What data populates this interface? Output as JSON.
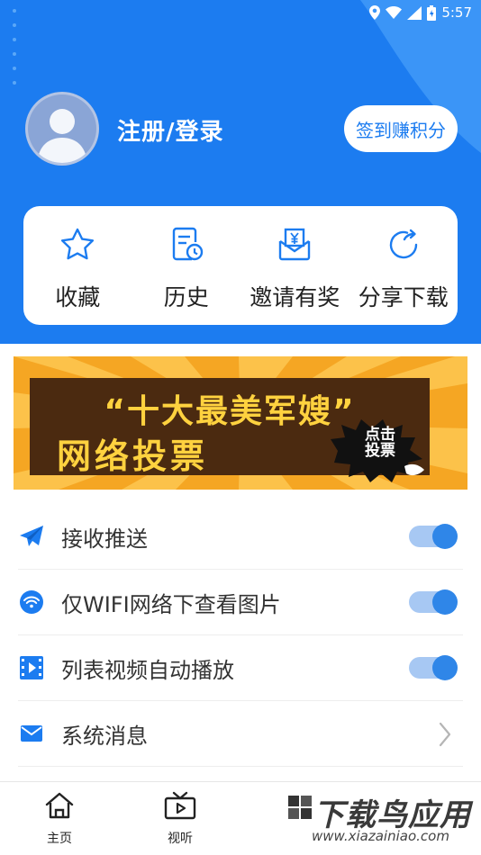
{
  "status_bar": {
    "time": "5:57"
  },
  "profile": {
    "login_label": "注册/登录",
    "signin_button": "签到赚积分"
  },
  "quick_actions": [
    {
      "label": "收藏",
      "icon": "star-icon"
    },
    {
      "label": "历史",
      "icon": "history-icon"
    },
    {
      "label": "邀请有奖",
      "icon": "invite-envelope-icon"
    },
    {
      "label": "分享下载",
      "icon": "share-icon"
    }
  ],
  "banner": {
    "line1": "“十大最美军嫂”",
    "line2": "网络投票",
    "badge": "点击投票"
  },
  "settings": [
    {
      "label": "接收推送",
      "icon": "paper-plane-icon",
      "type": "toggle",
      "on": true
    },
    {
      "label": "仅WIFI网络下查看图片",
      "icon": "wifi-icon",
      "type": "toggle",
      "on": true
    },
    {
      "label": "列表视频自动播放",
      "icon": "video-icon",
      "type": "toggle",
      "on": true
    },
    {
      "label": "系统消息",
      "icon": "mail-icon",
      "type": "link"
    }
  ],
  "bottom_nav": [
    {
      "label": "主页",
      "icon": "home-icon"
    },
    {
      "label": "视听",
      "icon": "tv-icon"
    }
  ],
  "watermark": {
    "main": "下载鸟应用",
    "sub": "www.xiazainiao.com"
  },
  "colors": {
    "primary": "#1c7cf0",
    "toggle_on": "#2f86e8",
    "banner_bg": "#f5a623",
    "banner_text": "#ffd23f"
  }
}
